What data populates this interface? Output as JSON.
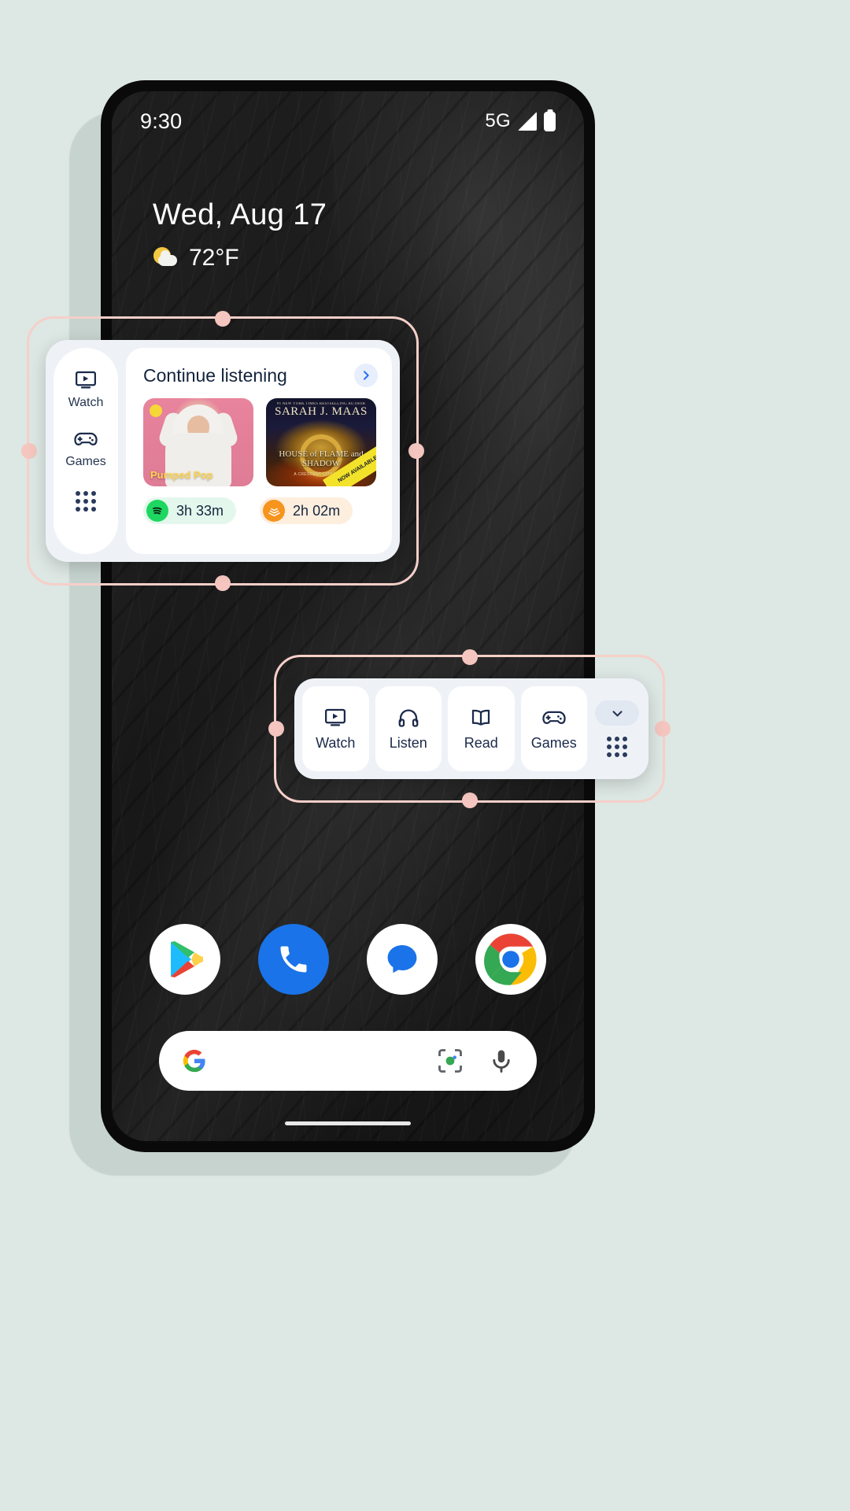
{
  "status_bar": {
    "time": "9:30",
    "network": "5G",
    "signal_icon": "signal-bars-icon",
    "battery_icon": "battery-full-icon"
  },
  "at_a_glance": {
    "date": "Wed, Aug 17",
    "temperature": "72°F",
    "weather_icon": "sun-behind-cloud-icon"
  },
  "widget_one": {
    "name": "Continue listening widget",
    "rail": [
      {
        "label": "Watch",
        "icon": "watch-tv-icon"
      },
      {
        "label": "Games",
        "icon": "game-controller-icon"
      },
      {
        "label": "",
        "icon": "app-grid-icon"
      }
    ],
    "header": {
      "title": "Continue listening",
      "more_icon": "chevron-right-icon"
    },
    "cards": [
      {
        "name": "Pumped Pop playlist",
        "overlay_title": "Pumped Pop",
        "badge": "explicit-badge"
      },
      {
        "name": "House of Flame and Shadow audiobook",
        "author": "SARAH J. MAAS",
        "author_kicker": "#1 NEW YORK TIMES BESTSELLING AUTHOR",
        "title": "HOUSE of FLAME and SHADOW",
        "subtitle": "A CRESCENT CITY NOVEL",
        "corner_banner": "NOW AVAILABLE"
      }
    ],
    "chips": [
      {
        "service": "Spotify",
        "icon": "spotify-icon",
        "duration": "3h 33m",
        "color": "#1ed760"
      },
      {
        "service": "Audible",
        "icon": "audible-icon",
        "duration": "2h 02m",
        "color": "#f7941e"
      }
    ]
  },
  "widget_two": {
    "name": "Entertainment categories widget",
    "tiles": [
      {
        "label": "Watch",
        "icon": "watch-tv-icon"
      },
      {
        "label": "Listen",
        "icon": "headphones-icon"
      },
      {
        "label": "Read",
        "icon": "open-book-icon"
      },
      {
        "label": "Games",
        "icon": "game-controller-icon"
      }
    ],
    "aside": {
      "collapse_icon": "chevron-down-icon",
      "grid_icon": "app-grid-icon"
    }
  },
  "dock": {
    "items": [
      {
        "label": "Play Store",
        "icon": "play-store-icon"
      },
      {
        "label": "Phone",
        "icon": "phone-icon"
      },
      {
        "label": "Messages",
        "icon": "messages-icon"
      },
      {
        "label": "Chrome",
        "icon": "chrome-icon"
      }
    ]
  },
  "search_bar": {
    "google_icon": "google-g-icon",
    "lens_icon": "google-lens-icon",
    "mic_icon": "microphone-icon",
    "placeholder": ""
  },
  "callouts": [
    {
      "name": "callout-continue-listening"
    },
    {
      "name": "callout-categories"
    }
  ],
  "colors": {
    "callout_border": "#f6cfc9",
    "handle": "#f4c6bf",
    "widget_bg": "#eef2f7",
    "widget_ink": "#1b2a4a",
    "page_bg": "#dde7e3"
  }
}
